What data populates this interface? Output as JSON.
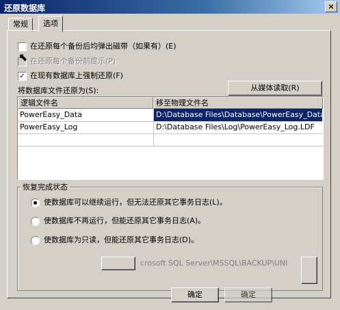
{
  "window": {
    "title": "还原数据库",
    "close_glyph": "×"
  },
  "tabs": [
    {
      "label": "常规"
    },
    {
      "label": "选项"
    }
  ],
  "options": {
    "eject": {
      "label": "在还原每个备份后均弹出磁带（如果有）(E)",
      "checked": false
    },
    "prompt": {
      "label": "在还原每个备份前提示(P)",
      "checked": false,
      "disabled": true
    },
    "force": {
      "label": "在现有数据库上强制还原(F)",
      "checked": true
    }
  },
  "restore_as_label": "将数据库文件还原为(S):",
  "read_from_media_button": "从媒体读取(R)",
  "grid": {
    "columns": [
      "逻辑文件名",
      "移至物理文件名"
    ],
    "rows": [
      [
        "PowerEasy_Data",
        "D:\\Database Files\\Database\\PowerEasy_Data..."
      ],
      [
        "PowerEasy_Log",
        "D:\\Database Files\\Log\\PowerEasy_Log.LDF"
      ]
    ]
  },
  "recovery": {
    "label": "恢复完成状态",
    "options": [
      {
        "label": "使数据库可以继续运行，但无法还原其它事务日志(L)。",
        "selected": true
      },
      {
        "label": "使数据库不再运行，但能还原其它事务日志(A)。",
        "selected": false
      },
      {
        "label": "使数据库为只读，但能还原其它事务日志(D)。",
        "selected": false
      }
    ],
    "ghost_path": "crosoft SQL Server\\MSSQL\\BACKUP\\UNI"
  },
  "ok_button": "确定",
  "ok_button_ghost": "确定"
}
